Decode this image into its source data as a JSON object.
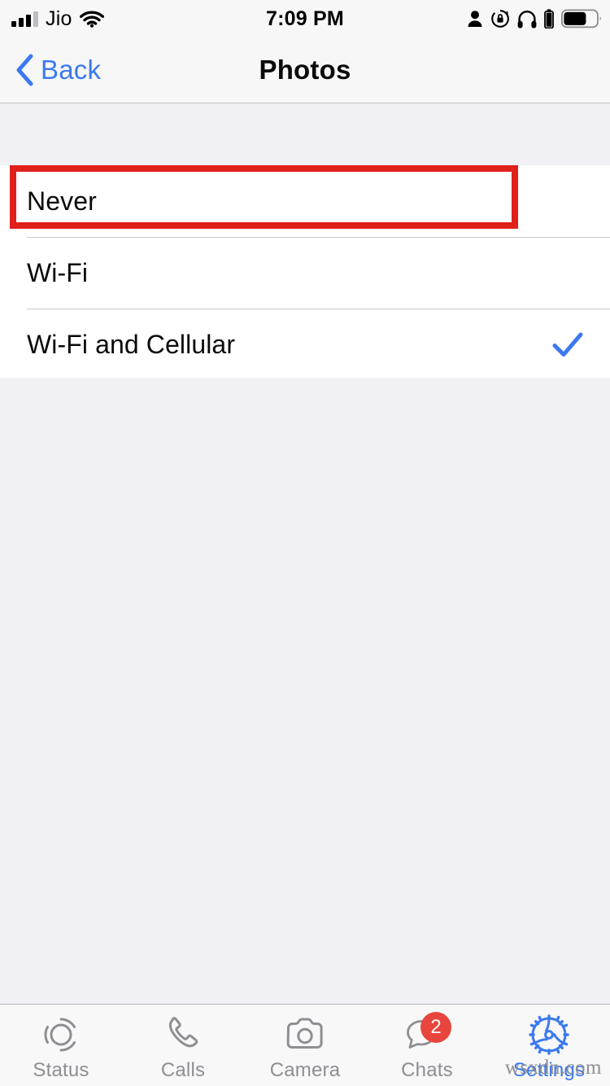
{
  "status_bar": {
    "carrier": "Jio",
    "time": "7:09 PM",
    "signal_bars_filled": 3,
    "signal_bars_total": 4,
    "icons": [
      "signal-bars-icon",
      "wifi-icon",
      "person-icon",
      "rotation-lock-icon",
      "headphones-icon",
      "headphones-battery-icon",
      "battery-icon"
    ]
  },
  "nav_bar": {
    "back_label": "Back",
    "title": "Photos",
    "back_icon": "chevron-left-icon"
  },
  "list": {
    "options": [
      {
        "label": "Never",
        "selected": false,
        "highlighted": true
      },
      {
        "label": "Wi-Fi",
        "selected": false,
        "highlighted": false
      },
      {
        "label": "Wi-Fi and Cellular",
        "selected": true,
        "highlighted": false
      }
    ],
    "checkmark_icon": "checkmark-icon"
  },
  "annotation": {
    "type": "rectangle-highlight",
    "target": "Never",
    "color": "#E0201B"
  },
  "tab_bar": {
    "tabs": [
      {
        "label": "Status",
        "icon": "status-rings-icon",
        "active": false,
        "badge": ""
      },
      {
        "label": "Calls",
        "icon": "phone-icon",
        "active": false,
        "badge": ""
      },
      {
        "label": "Camera",
        "icon": "camera-icon",
        "active": false,
        "badge": ""
      },
      {
        "label": "Chats",
        "icon": "chat-bubbles-icon",
        "active": false,
        "badge": "2"
      },
      {
        "label": "Settings",
        "icon": "gear-icon",
        "active": true,
        "badge": ""
      }
    ]
  },
  "watermark": {
    "text": "wsxdn.com"
  },
  "colors": {
    "accent_blue": "#3C79F0",
    "annotation_red": "#E0201B",
    "badge_red": "#E8453C",
    "inactive_gray": "#8E8E93",
    "page_background": "#F1F0F5"
  }
}
